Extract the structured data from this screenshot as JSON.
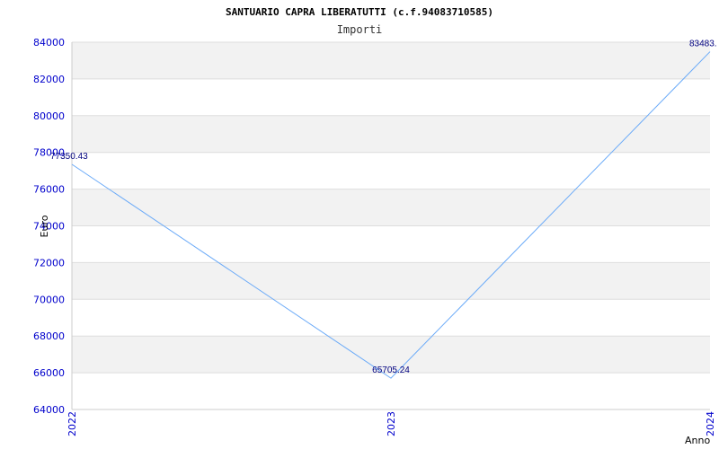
{
  "chart_data": {
    "type": "line",
    "title": "SANTUARIO CAPRA LIBERATUTTI (c.f.94083710585)",
    "subtitle": "Importi",
    "xlabel": "Anno",
    "ylabel": "Euro",
    "categories": [
      "2022",
      "2023",
      "2024"
    ],
    "series": [
      {
        "values": [
          77350.43,
          65705.24,
          83483
        ],
        "labels": [
          "77350.43",
          "65705.24",
          "83483."
        ]
      }
    ],
    "yticks": [
      "64000",
      "66000",
      "68000",
      "70000",
      "72000",
      "74000",
      "76000",
      "78000",
      "80000",
      "82000",
      "84000"
    ],
    "ylim": [
      64000,
      84000
    ],
    "grid": true,
    "colors": {
      "line": "#6aaaf8",
      "band": "#f2f2f2",
      "tick_text": "#0000cc",
      "data_label": "#000080"
    }
  }
}
